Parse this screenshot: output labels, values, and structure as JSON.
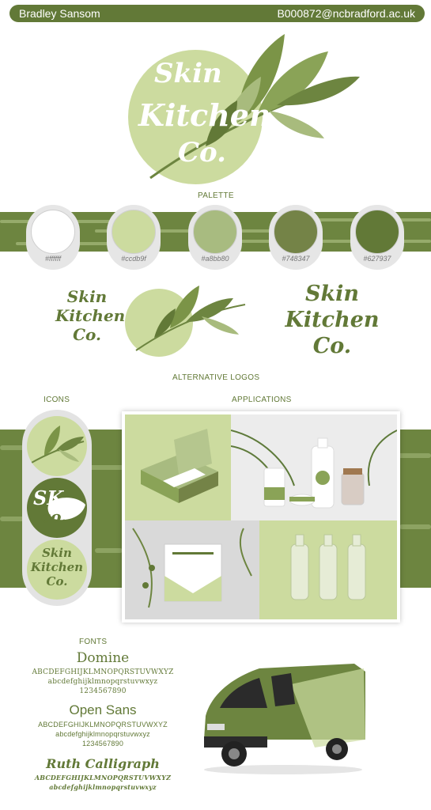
{
  "header": {
    "name": "Bradley Sansom",
    "email": "B000872@ncbradford.ac.uk"
  },
  "main_logo": {
    "line1": "Skin",
    "line2": "Kitchen",
    "line3": "Co."
  },
  "palette": {
    "label": "PALETTE",
    "swatches": [
      {
        "hex": "#ffffff",
        "code": "#ffffff"
      },
      {
        "hex": "#ccdb9f",
        "code": "#ccdb9f"
      },
      {
        "hex": "#a8bb80",
        "code": "#a8bb80"
      },
      {
        "hex": "#748347",
        "code": "#748347"
      },
      {
        "hex": "#627937",
        "code": "#627937"
      }
    ]
  },
  "alt_logos": {
    "label": "ALTERNATIVE LOGOS",
    "line1": "Skin",
    "line2": "Kitchen",
    "line3": "Co."
  },
  "icons": {
    "label": "ICONS",
    "monogram_1": "SK",
    "monogram_2": "co.",
    "line1": "Skin",
    "line2": "Kitchen",
    "line3": "Co."
  },
  "applications": {
    "label": "APPLICATIONS"
  },
  "fonts": {
    "label": "FONTS",
    "domine": {
      "name": "Domine",
      "upper": "ABCDEFGHIJKLMNOPQRSTUVWXYZ",
      "lower": "abcdefghijklmnopqrstuvwxyz",
      "digits": "1234567890"
    },
    "open_sans": {
      "name": "Open Sans",
      "upper": "ABCDEFGHIJKLMNOPQRSTUVWXYZ",
      "lower": "abcdefghijklmnopqrstuvwxyz",
      "digits": "1234567890"
    },
    "ruth": {
      "name": "Ruth Calligraph",
      "upper": "ABCDEFGHIJKLMNOPQRSTUVWXYZ",
      "lower": "abcdefghijklmnopqrstuvwxyz"
    }
  }
}
